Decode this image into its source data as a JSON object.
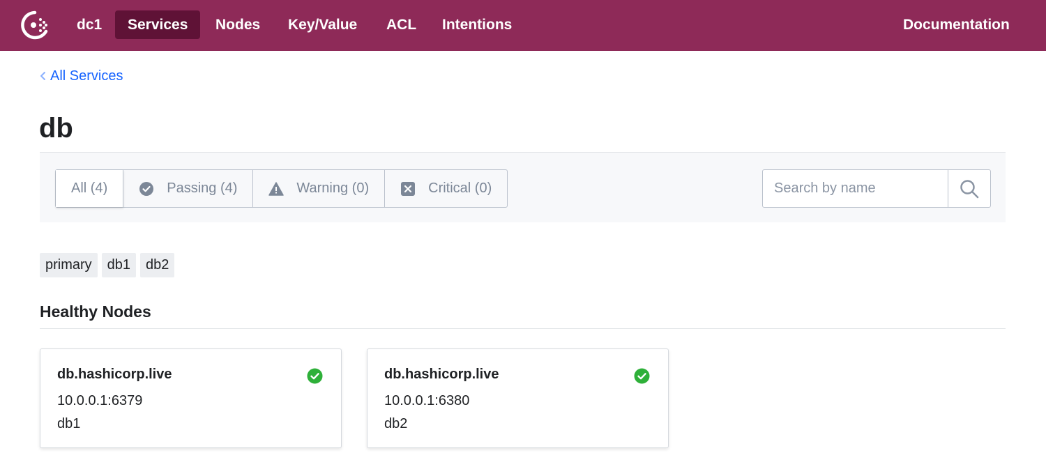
{
  "header": {
    "datacenter": "dc1",
    "nav": [
      {
        "label": "Services",
        "active": true
      },
      {
        "label": "Nodes",
        "active": false
      },
      {
        "label": "Key/Value",
        "active": false
      },
      {
        "label": "ACL",
        "active": false
      },
      {
        "label": "Intentions",
        "active": false
      }
    ],
    "documentation": "Documentation"
  },
  "breadcrumb": {
    "label": "All Services"
  },
  "page": {
    "title": "db"
  },
  "filters": {
    "tabs": [
      {
        "label": "All (4)",
        "icon": "none",
        "selected": true
      },
      {
        "label": "Passing (4)",
        "icon": "check-circle-icon",
        "selected": false
      },
      {
        "label": "Warning (0)",
        "icon": "warning-triangle-icon",
        "selected": false
      },
      {
        "label": "Critical (0)",
        "icon": "critical-x-icon",
        "selected": false
      }
    ],
    "search_placeholder": "Search by name"
  },
  "tags": [
    "primary",
    "db1",
    "db2"
  ],
  "healthy_nodes": {
    "title": "Healthy Nodes",
    "nodes": [
      {
        "name": "db.hashicorp.live",
        "address": "10.0.0.1:6379",
        "node": "db1",
        "status": "passing"
      },
      {
        "name": "db.hashicorp.live",
        "address": "10.0.0.1:6380",
        "node": "db2",
        "status": "passing"
      }
    ]
  },
  "colors": {
    "brand": "#8e2a58",
    "nav_active": "#5f1236",
    "link": "#1563ff",
    "passing": "#2eb039"
  }
}
